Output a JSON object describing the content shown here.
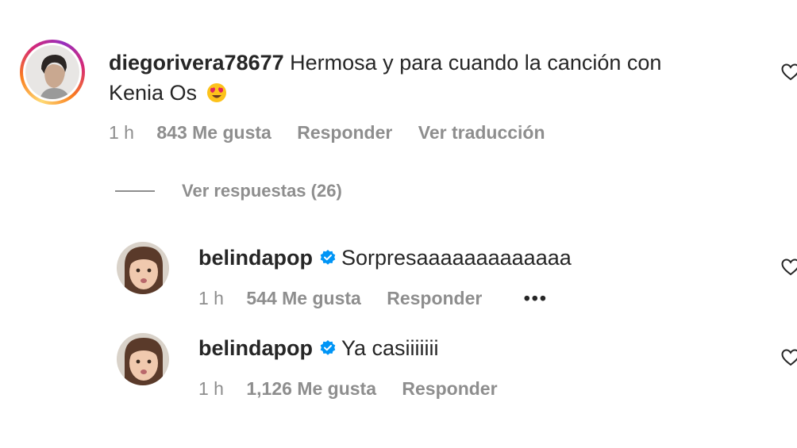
{
  "comments": [
    {
      "username": "diegorivera78677",
      "text_line1": "Hermosa y para cuando la canción con",
      "text_line2": "Kenia Os",
      "time": "1 h",
      "likes": "843 Me gusta",
      "reply": "Responder",
      "translate": "Ver traducción",
      "verified": false,
      "emoji": "heart-eyes-emoji"
    }
  ],
  "view_replies": "Ver respuestas (26)",
  "replies": [
    {
      "username": "belindapop",
      "text": "Sorpresaaaaaaaaaaaaa",
      "time": "1 h",
      "likes": "544 Me gusta",
      "reply": "Responder",
      "more": "•••",
      "verified": true
    },
    {
      "username": "belindapop",
      "text": "Ya casiiiiiii",
      "time": "1 h",
      "likes": "1,126 Me gusta",
      "reply": "Responder",
      "verified": true
    }
  ],
  "icons": {
    "like": "heart-outline-icon",
    "verified": "verified-badge-icon",
    "more": "more-options-icon"
  },
  "colors": {
    "text": "#262626",
    "secondary": "#8e8e8e",
    "verified": "#0095f6"
  }
}
